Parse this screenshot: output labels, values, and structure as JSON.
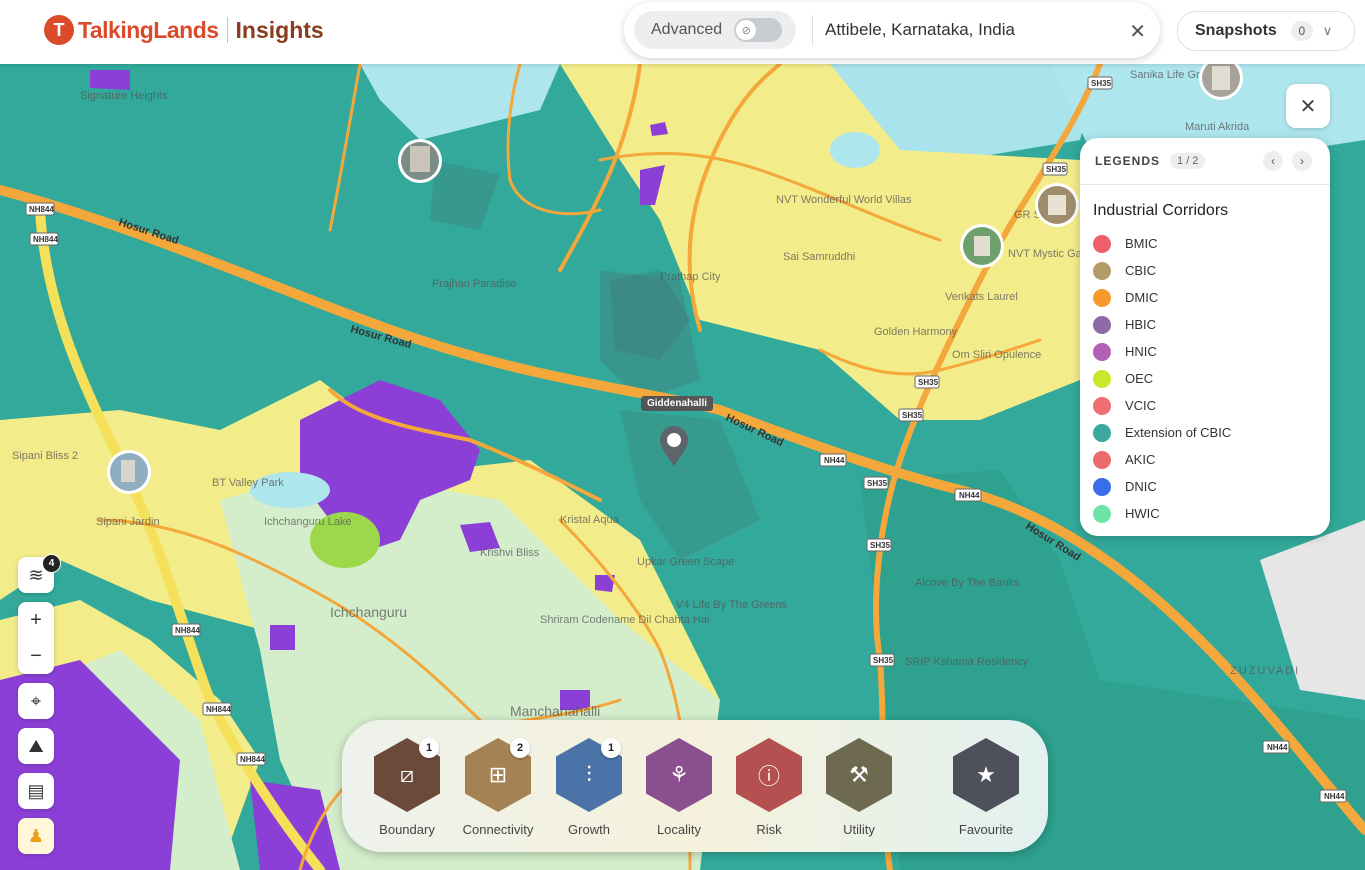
{
  "header": {
    "brand": "TalkingLands",
    "product": "Insights",
    "search": {
      "advanced_label": "Advanced",
      "value": "Attibele, Karnataka, India"
    },
    "snapshots": {
      "label": "Snapshots",
      "count": "0"
    }
  },
  "map": {
    "pin_label": "Giddenahalli",
    "labels": {
      "hosur1": "Hosur Road",
      "hosur2": "Hosur Road",
      "hosur3": "Hosur Road",
      "hosur4": "Hosur Road",
      "nh844a": "NH844",
      "nh844b": "NH844",
      "nh844c": "NH844",
      "nh844d": "NH844",
      "nh44a": "NH44",
      "nh44b": "NH44",
      "nh44c": "NH44",
      "nh44d": "NH44",
      "sh35a": "SH35",
      "sh35b": "SH35",
      "sh35c": "SH35",
      "sh35d": "SH35",
      "sh35e": "SH35",
      "sh35f": "SH35",
      "sh35g": "SH35",
      "sh35h": "SH35",
      "signature": "Signature Heights",
      "nvt": "NVT Wonderful World Villas",
      "sai": "Sai Samruddhi",
      "gr": "GR Sanskriti",
      "nvtmystic": "NVT Mystic Gardens",
      "venkat": "Venkats Laurel",
      "golden": "Golden Harmony",
      "omsiri": "Om Sliri Opulence",
      "sipani": "Sipani Bliss 2",
      "sipanijardin": "Sipani Jardin",
      "valley": "BT Valley Park",
      "ichanguru": "Ichchanguru Lake",
      "kristal": "Kristal Aqua",
      "krishvi": "Krishvi Bliss",
      "upkar": "Upkar Green Scape",
      "shriram": "Shriram Codename Dil Chahta Hai",
      "life": "V4 Life By The Greens",
      "manchanahalli": "Manchanahalli",
      "ichangurubig": "Ichchanguru",
      "prajhan": "Prajhan Paradise",
      "maruti": "Maruti Akrida",
      "alcove": "Alcove By The Banks",
      "srip": "SRIP Kshama Residency",
      "zuzuvadi": "ZUZUVADI",
      "pratappa": "Prathap City",
      "sanika": "Sanika Life Green"
    }
  },
  "legend": {
    "title": "LEGENDS",
    "page": "1 / 2",
    "subtitle": "Industrial Corridors",
    "items": [
      {
        "label": "BMIC",
        "color": "#ec5f6b"
      },
      {
        "label": "CBIC",
        "color": "#b39c6a"
      },
      {
        "label": "DMIC",
        "color": "#f79a2b"
      },
      {
        "label": "HBIC",
        "color": "#8b6ba8"
      },
      {
        "label": "HNIC",
        "color": "#b35fb8"
      },
      {
        "label": "OEC",
        "color": "#c9e82a"
      },
      {
        "label": "VCIC",
        "color": "#ef6e72"
      },
      {
        "label": "Extension of CBIC",
        "color": "#3aa89c"
      },
      {
        "label": "AKIC",
        "color": "#ec6a6a"
      },
      {
        "label": "DNIC",
        "color": "#3a6ee8"
      },
      {
        "label": "HWIC",
        "color": "#6ee3a8"
      }
    ]
  },
  "controls": {
    "layer_count": "4"
  },
  "dock": {
    "categories": [
      {
        "label": "Boundary",
        "badge": "1",
        "color": "#6b4a3a"
      },
      {
        "label": "Connectivity",
        "badge": "2",
        "color": "#a58253"
      },
      {
        "label": "Growth",
        "badge": "1",
        "color": "#4b73a8"
      },
      {
        "label": "Locality",
        "badge": "",
        "color": "#8a4f8f"
      },
      {
        "label": "Risk",
        "badge": "",
        "color": "#b45050"
      },
      {
        "label": "Utility",
        "badge": "",
        "color": "#6e6a50"
      },
      {
        "label": "Favourite",
        "badge": "",
        "color": "#4e505c"
      }
    ]
  }
}
